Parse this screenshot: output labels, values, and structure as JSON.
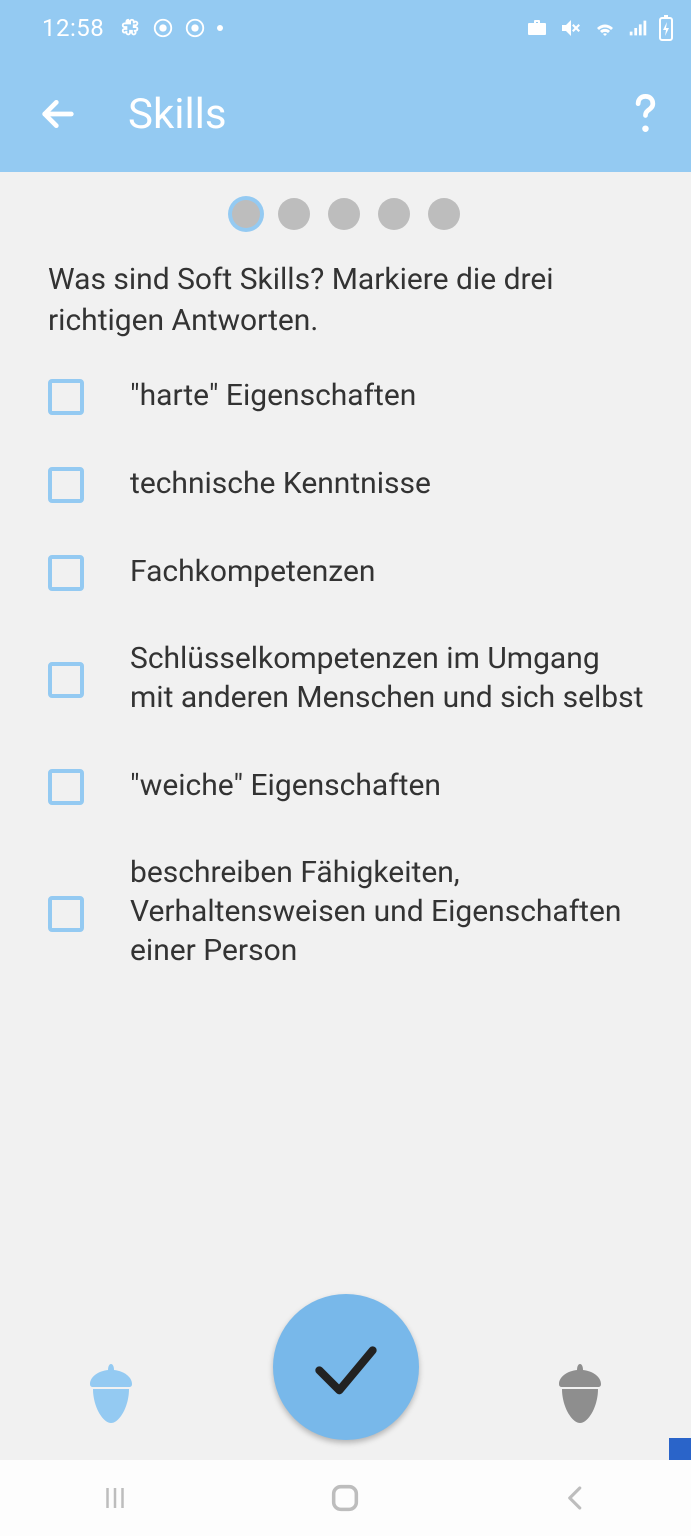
{
  "statusbar": {
    "time": "12:58"
  },
  "appbar": {
    "title": "Skills"
  },
  "progress": {
    "total": 5,
    "current": 1
  },
  "question": "Was sind Soft Skills? Markiere die drei richtigen Antworten.",
  "options": [
    {
      "label": "\"harte\" Eigenschaften"
    },
    {
      "label": "technische Kenntnisse"
    },
    {
      "label": "Fachkompetenzen"
    },
    {
      "label": "Schlüsselkompetenzen im Umgang mit anderen Menschen und sich selbst"
    },
    {
      "label": "\"weiche\" Eigenschaften"
    },
    {
      "label": "beschreiben Fähigkeiten, Verhaltensweisen und Eigenschaften einer Person"
    }
  ]
}
